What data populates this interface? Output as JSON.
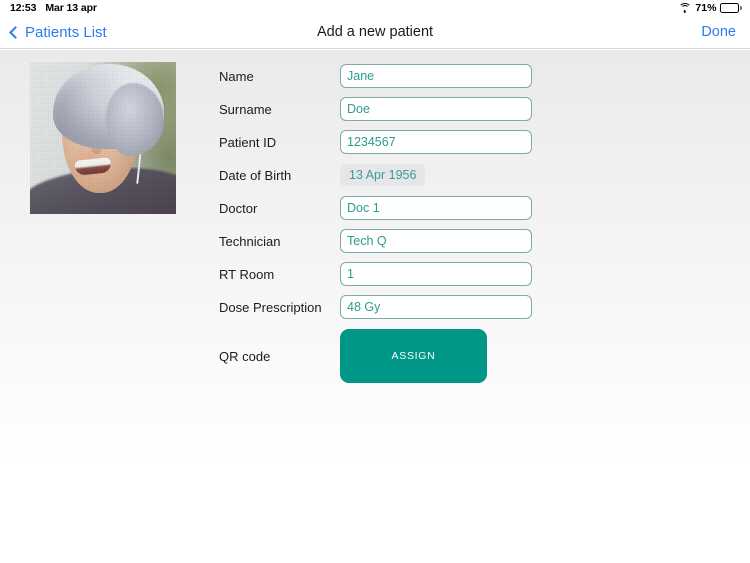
{
  "status_bar": {
    "time": "12:53",
    "date": "Mar 13 apr",
    "wifi_icon": "wifi-icon",
    "battery_percent": "71%",
    "battery_icon": "battery-icon",
    "battery_level": 71
  },
  "nav_bar": {
    "back_icon": "chevron-left-icon",
    "back_label": "Patients List",
    "title": "Add a new patient",
    "done_label": "Done"
  },
  "photo": {
    "name": "patient-photo"
  },
  "form": {
    "fields": [
      {
        "label": "Name",
        "value": "Jane",
        "type": "text"
      },
      {
        "label": "Surname",
        "value": "Doe",
        "type": "text"
      },
      {
        "label": "Patient ID",
        "value": "1234567",
        "type": "text"
      },
      {
        "label": "Date of Birth",
        "value": "13 Apr 1956",
        "type": "date"
      },
      {
        "label": "Doctor",
        "value": "Doc 1",
        "type": "text"
      },
      {
        "label": "Technician",
        "value": "Tech Q",
        "type": "text"
      },
      {
        "label": "RT Room",
        "value": "1",
        "type": "text"
      },
      {
        "label": "Dose Prescription",
        "value": "48 Gy",
        "type": "text"
      }
    ],
    "qr_label": "QR code",
    "assign_label": "ASSIGN"
  },
  "colors": {
    "accent_teal": "#009688",
    "field_text": "#2e9b8f",
    "link_blue": "#2b7cf0",
    "field_border": "#7fa9a5",
    "date_pill_bg": "#e6e6e9"
  }
}
